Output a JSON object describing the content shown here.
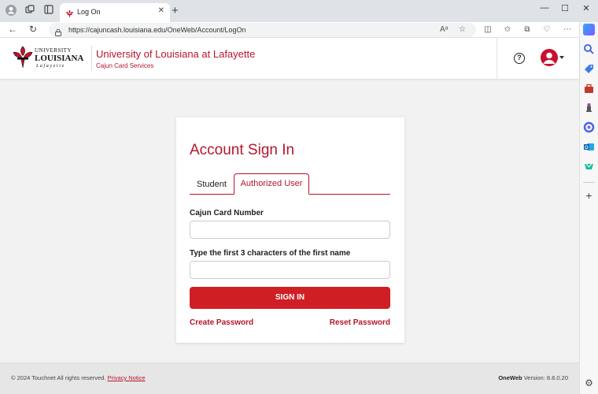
{
  "browser": {
    "tab_title": "Log On",
    "tab_close": "✕",
    "new_tab": "+",
    "url": "https://cajuncash.louisiana.edu/OneWeb/Account/LogOn",
    "window_controls": [
      "—",
      "☐",
      "✕"
    ]
  },
  "header": {
    "logo_line1": "UNIVERSITY",
    "logo_line2": "LOUISIANA",
    "logo_line3": "Lafayette",
    "title": "University of Louisiana at Lafayette",
    "subtitle": "Cajun Card Services",
    "help_icon": "?"
  },
  "signin": {
    "title": "Account Sign In",
    "tabs": [
      {
        "label": "Student",
        "active": false
      },
      {
        "label": "Authorized User",
        "active": true
      }
    ],
    "card_number_label": "Cajun Card Number",
    "card_number_value": "",
    "first_name_label": "Type the first 3 characters of the first name",
    "first_name_value": "",
    "signin_label": "SIGN IN",
    "create_password": "Create Password",
    "reset_password": "Reset Password"
  },
  "footer": {
    "copyright": "© 2024 Touchnet All rights reserved.",
    "privacy": "Privacy Notice",
    "brand": "OneWeb",
    "version": "Version: 8.8.0.20"
  },
  "colors": {
    "brand_red": "#b5162b",
    "button_red": "#cf1f24"
  }
}
